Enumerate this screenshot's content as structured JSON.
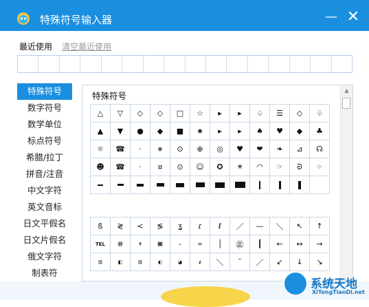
{
  "window": {
    "title": "特殊符号输入器",
    "minimize_glyph": "—",
    "close_glyph": "✕"
  },
  "recent": {
    "label": "最近使用",
    "clear_label": "清空最近使用",
    "slots": 16
  },
  "categories": [
    {
      "label": "特殊符号",
      "active": true
    },
    {
      "label": "数字符号"
    },
    {
      "label": "数学单位"
    },
    {
      "label": "标点符号"
    },
    {
      "label": "希腊/拉丁"
    },
    {
      "label": "拼音/注音"
    },
    {
      "label": "中文字符"
    },
    {
      "label": "英文音标"
    },
    {
      "label": "日文平假名"
    },
    {
      "label": "日文片假名"
    },
    {
      "label": "俄文字符"
    },
    {
      "label": "制表符"
    }
  ],
  "panel": {
    "title": "特殊符号",
    "symbols": [
      "△",
      "▽",
      "◇",
      "◇",
      "□",
      "☆",
      "▸",
      "▸",
      "♤",
      "☰",
      "◇",
      "♧",
      "•",
      "▲",
      "▼",
      "●",
      "◆",
      "■",
      "★",
      "▸",
      "▸",
      "♠",
      "♥",
      "◆",
      "♣",
      "··",
      "☼",
      "☎",
      "·",
      "∗",
      "⊙",
      "⊕",
      "◎",
      "♥",
      "❤",
      "❧",
      "⊿",
      "☊",
      "∗∗",
      "☻",
      "☎",
      "·",
      "¤",
      "⊙",
      "☺",
      "✪",
      "☀",
      "◠",
      "☞",
      "ᘐ",
      "⁘",
      "······"
    ],
    "bars": [
      1,
      2,
      3,
      4,
      5,
      6,
      7,
      8,
      1,
      2,
      3,
      4
    ],
    "symbols2": [
      "ß",
      "≷",
      "<",
      "≶",
      "ʓ",
      "ɾ",
      "ℓ",
      "／",
      "—",
      "＼",
      "↖",
      "↑",
      "↗",
      "TEL",
      "Ⓜ",
      "ª",
      "㈱",
      "–",
      "＝",
      "│",
      "㊣",
      "┃",
      "←",
      "↔",
      "→",
      "⊠",
      "⊟",
      "◧",
      "⊡",
      "◐",
      "◕",
      "ɾ",
      "＼",
      "¯",
      "／",
      "↙",
      "↓",
      "↘"
    ]
  },
  "brand": {
    "name": "系统天地",
    "url": "XiTongTianDi.net"
  },
  "colors": {
    "accent": "#1a8fe0"
  }
}
